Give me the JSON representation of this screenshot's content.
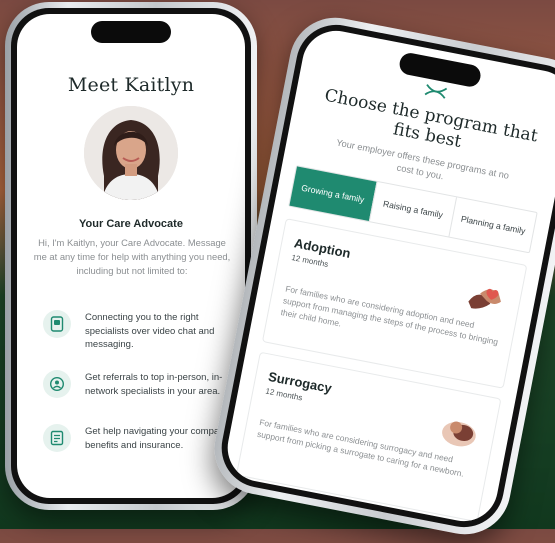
{
  "left_screen": {
    "title": "Meet Kaitlyn",
    "advocate_title": "Your Care Advocate",
    "intro": "Hi, I'm Kaitlyn, your Care Advocate. Message me at any time for help with anything you need, including but not limited to:",
    "features": [
      {
        "icon": "video-chat-icon",
        "text": "Connecting you to the right specialists over video chat and messaging."
      },
      {
        "icon": "referral-icon",
        "text": "Get referrals to top in-person, in-network specialists in your area."
      },
      {
        "icon": "document-icon",
        "text": "Get help navigating your company benefits and insurance."
      }
    ]
  },
  "right_screen": {
    "logo_icon": "maven-logo-icon",
    "title": "Choose the program that fits best",
    "subtitle": "Your employer offers these programs at no cost to you.",
    "tabs": [
      {
        "label": "Growing a family",
        "active": true
      },
      {
        "label": "Raising a family",
        "active": false
      },
      {
        "label": "Planning a family",
        "active": false
      }
    ],
    "programs": [
      {
        "title": "Adoption",
        "duration": "12 months",
        "description": "For families who are considering adoption and need support from managing the steps of the process to bringing their child home.",
        "icon": "hands-heart-icon"
      },
      {
        "title": "Surrogacy",
        "duration": "12 months",
        "description": "For families who are considering surrogacy and need support from picking a surrogate to caring for a newborn.",
        "icon": "newborn-icon"
      }
    ]
  },
  "colors": {
    "accent": "#1f8a70",
    "accent_light": "#e6f2ee",
    "text_dark": "#1e2a2a",
    "text_muted": "#8b8f92"
  }
}
